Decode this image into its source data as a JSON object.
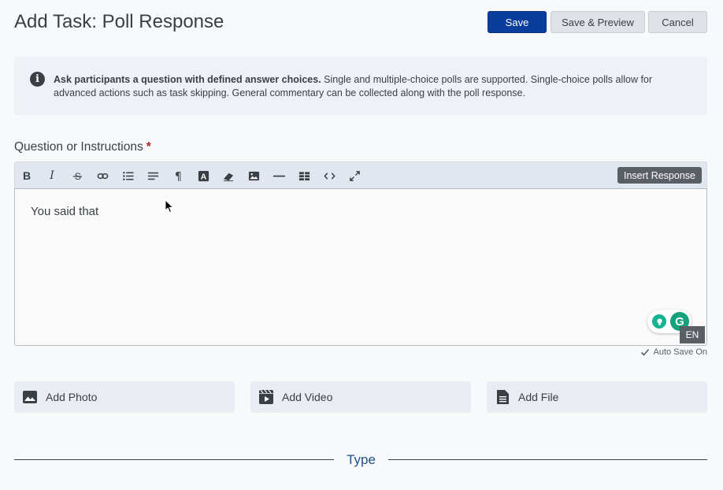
{
  "header": {
    "title": "Add Task: Poll Response",
    "save_label": "Save",
    "preview_label": "Save & Preview",
    "cancel_label": "Cancel"
  },
  "info": {
    "icon": "info-icon",
    "bold_text": "Ask participants a question with defined answer choices.",
    "text": " Single and multiple-choice polls are supported. Single-choice polls allow for advanced actions such as task skipping. General commentary can be collected along with the poll response."
  },
  "question": {
    "label": "Question or Instructions",
    "required_mark": "*"
  },
  "toolbar": {
    "bold": "B",
    "italic": "I",
    "insert_response_label": "Insert Response"
  },
  "editor": {
    "content": "You said that",
    "language_badge": "EN"
  },
  "autosave": {
    "label": "Auto Save On"
  },
  "media": {
    "photo_label": "Add Photo",
    "video_label": "Add Video",
    "file_label": "Add File"
  },
  "section": {
    "type_title": "Type"
  },
  "colors": {
    "primary": "#0b3d9c",
    "grammarly": "#15a17d",
    "required": "#b22222",
    "section_title": "#1f4f8a"
  }
}
